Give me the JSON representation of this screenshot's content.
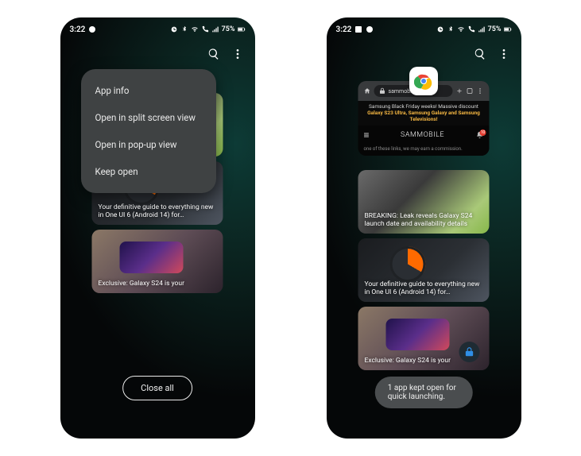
{
  "status": {
    "time": "3:22",
    "battery_pct": "75%"
  },
  "toolbar": {
    "search_name": "search-icon",
    "overflow_name": "more-icon"
  },
  "popup": {
    "items": [
      {
        "label": "App info"
      },
      {
        "label": "Open in split screen view"
      },
      {
        "label": "Open in pop-up view"
      },
      {
        "label": "Keep open"
      }
    ]
  },
  "cards": [
    {
      "caption": "BREAKING: Leak reveals Galaxy S24 launch date and availability details"
    },
    {
      "caption": "Your definitive guide to everything new in One UI 6 (Android 14) for…"
    },
    {
      "caption": "Exclusive: Galaxy S24 is your"
    }
  ],
  "close_all": "Close all",
  "browser": {
    "url_host": "sammobi…",
    "banner_prefix": "Samsung Black Friday weeks! Massive discount ",
    "banner_highlight": "Galaxy S23 Ultra, Samsung Galaxy and Samsung Televisions!",
    "logo1": "SAM",
    "logo2": "MOBILE",
    "notif_count": "10",
    "subhead": "one of these links, we may earn a commission."
  },
  "toast": "1 app kept open for quick launching."
}
